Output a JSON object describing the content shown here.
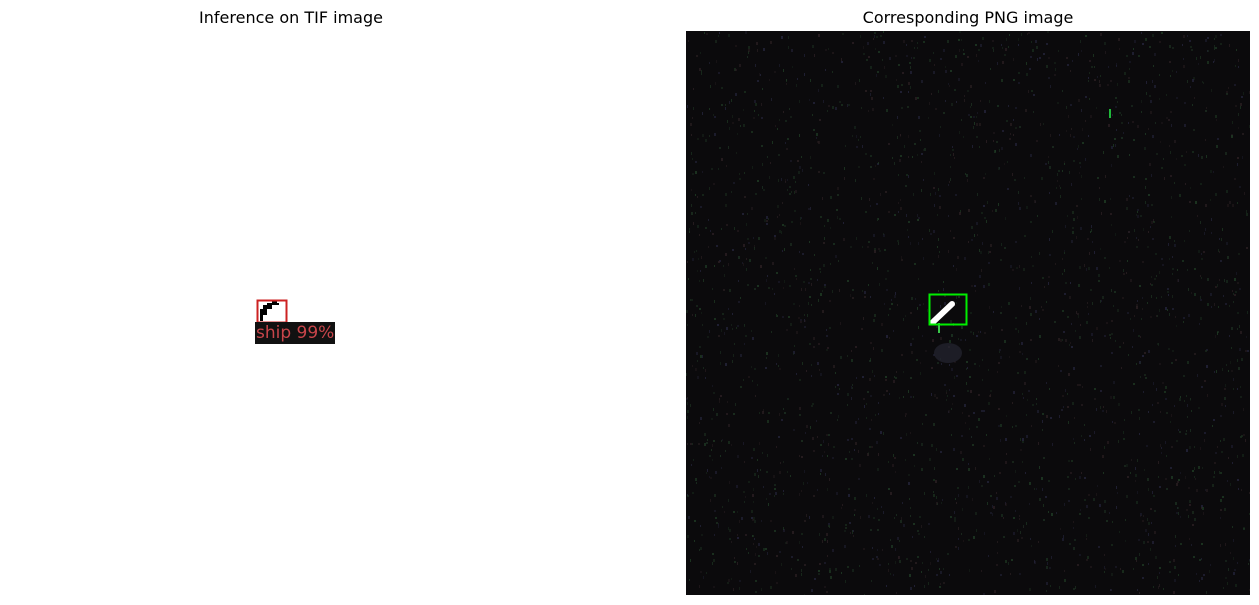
{
  "figure": {
    "left_title": "Inference on TIF image",
    "right_title": "Corresponding PNG image"
  },
  "tif_panel": {
    "background_color": "#ffffff",
    "detection": {
      "label": "ship 99%",
      "box_color": "#cc2222",
      "label_text_color": "#c8454a",
      "label_background": "#111111"
    }
  },
  "png_panel": {
    "background_color": "#0b0a0c",
    "noise_colors": [
      "#1f3a24",
      "#2a1f22",
      "#24243a",
      "#1c2e20"
    ],
    "detection": {
      "box_color": "#00ee00",
      "object_color": "#f4fff4"
    }
  }
}
